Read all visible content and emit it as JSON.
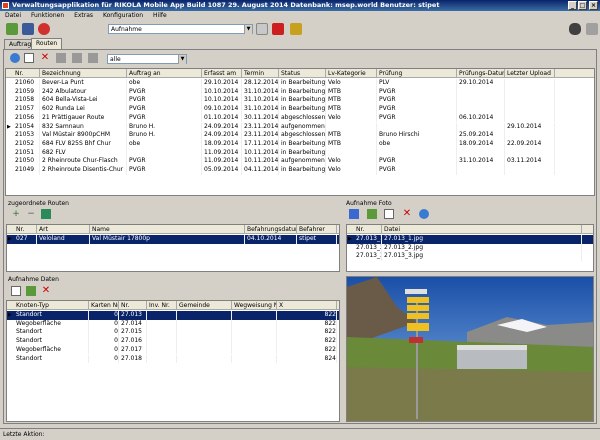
{
  "window": {
    "title": "Verwaltungsapplikation für RIKOLA Mobile App   Build 1087 29. August 2014     Datenbank: msep.world    Benutzer: stipet"
  },
  "menu": [
    "Datei",
    "Funktionen",
    "Extras",
    "Konfiguration",
    "Hilfe"
  ],
  "toolbar": {
    "report_select": "Aufnahme"
  },
  "tabs": [
    "Auftrag",
    "Routen"
  ],
  "filter": {
    "value": "alle"
  },
  "routes": {
    "columns": [
      "Nr.",
      "Bezeichnung",
      "Auftrag an",
      "Erfasst am",
      "Termin",
      "Status",
      "Lv-Kategorie",
      "Prüfung",
      "Prüfungs-Datum",
      "Letzter Upload"
    ],
    "rows": [
      [
        "21060",
        "Bever-La Punt",
        "obe",
        "29.10.2014",
        "28.12.2014",
        "in Bearbeitung",
        "Velo",
        "PLV",
        "29.10.2014",
        ""
      ],
      [
        "21059",
        "242 Albulatour",
        "PVGR",
        "10.10.2014",
        "31.10.2014",
        "in Bearbeitung",
        "MTB",
        "PVGR",
        "",
        ""
      ],
      [
        "21058",
        "604 Bella-Vista-Lei",
        "PVGR",
        "10.10.2014",
        "31.10.2014",
        "in Bearbeitung",
        "MTB",
        "PVGR",
        "",
        ""
      ],
      [
        "21057",
        "602 Runda Lei",
        "PVGR",
        "09.10.2014",
        "31.10.2014",
        "in Bearbeitung",
        "MTB",
        "PVGR",
        "",
        ""
      ],
      [
        "21056",
        "21 Prättigauer Route",
        "PVGR",
        "01.10.2014",
        "30.11.2014",
        "abgeschlossen",
        "Velo",
        "PVGR",
        "06.10.2014",
        ""
      ],
      [
        "21054",
        "832 Samnaun",
        "Bruno H.",
        "24.09.2014",
        "23.11.2014",
        "aufgenommen",
        "",
        "",
        "",
        "29.10.2014"
      ],
      [
        "21053",
        "Val Müstair 8900pCHM",
        "Bruno H.",
        "24.09.2014",
        "23.11.2014",
        "abgeschlossen",
        "MTB",
        "Bruno Hirschi",
        "25.09.2014",
        ""
      ],
      [
        "21052",
        "684 FLV 825S Bhf Chur",
        "obe",
        "18.09.2014",
        "17.11.2014",
        "in Bearbeitung",
        "MTB",
        "obe",
        "18.09.2014",
        "22.09.2014"
      ],
      [
        "21051",
        "682 FLV",
        "",
        "11.09.2014",
        "10.11.2014",
        "in Bearbeitung",
        "",
        "",
        "",
        ""
      ],
      [
        "21050",
        "2 Rheinroute Chur-Flasch",
        "PVGR",
        "11.09.2014",
        "10.11.2014",
        "aufgenommen",
        "Velo",
        "PVGR",
        "31.10.2014",
        "03.11.2014"
      ],
      [
        "21049",
        "2 Rheinroute Disentis-Chur",
        "PVGR",
        "05.09.2014",
        "04.11.2014",
        "in Bearbeitung",
        "Velo",
        "PVGR",
        "",
        ""
      ]
    ]
  },
  "sub_routes": {
    "title": "zugeordnete Routen",
    "columns": [
      "Nr.",
      "Art",
      "Name",
      "Befahrungsdatum",
      "Befahrer"
    ],
    "rows": [
      [
        "027",
        "Veloland",
        "Val Müstair 17800p",
        "04.10.2014",
        "stipet"
      ]
    ]
  },
  "photos": {
    "title": "Aufnahme Foto",
    "columns": [
      "Nr.",
      "Datei"
    ],
    "rows": [
      [
        "27.013_1",
        "27.013_1.jpg"
      ],
      [
        "27.013_2",
        "27.013_2.jpg"
      ],
      [
        "27.013_3",
        "27.013_3.jpg"
      ]
    ]
  },
  "data": {
    "title": "Aufnahme Daten",
    "columns": [
      "Knoten-Typ",
      "Karten Nr.",
      "Nr.",
      "Inv. Nr.",
      "Gemeinde",
      "Wegweisung Nr.",
      "X"
    ],
    "rows": [
      [
        "Standort",
        "0",
        "27.013",
        "",
        "",
        "",
        "822"
      ],
      [
        "Wegoberfläche",
        "0",
        "27.014",
        "",
        "",
        "",
        "822"
      ],
      [
        "Standort",
        "0",
        "27.015",
        "",
        "",
        "",
        "822"
      ],
      [
        "Standort",
        "0",
        "27.016",
        "",
        "",
        "",
        "822"
      ],
      [
        "Wegoberfläche",
        "0",
        "27.017",
        "",
        "",
        "",
        "822"
      ],
      [
        "Standort",
        "0",
        "27.018",
        "",
        "",
        "",
        "824"
      ]
    ]
  },
  "status": {
    "label": "Letzte Aktion:"
  }
}
